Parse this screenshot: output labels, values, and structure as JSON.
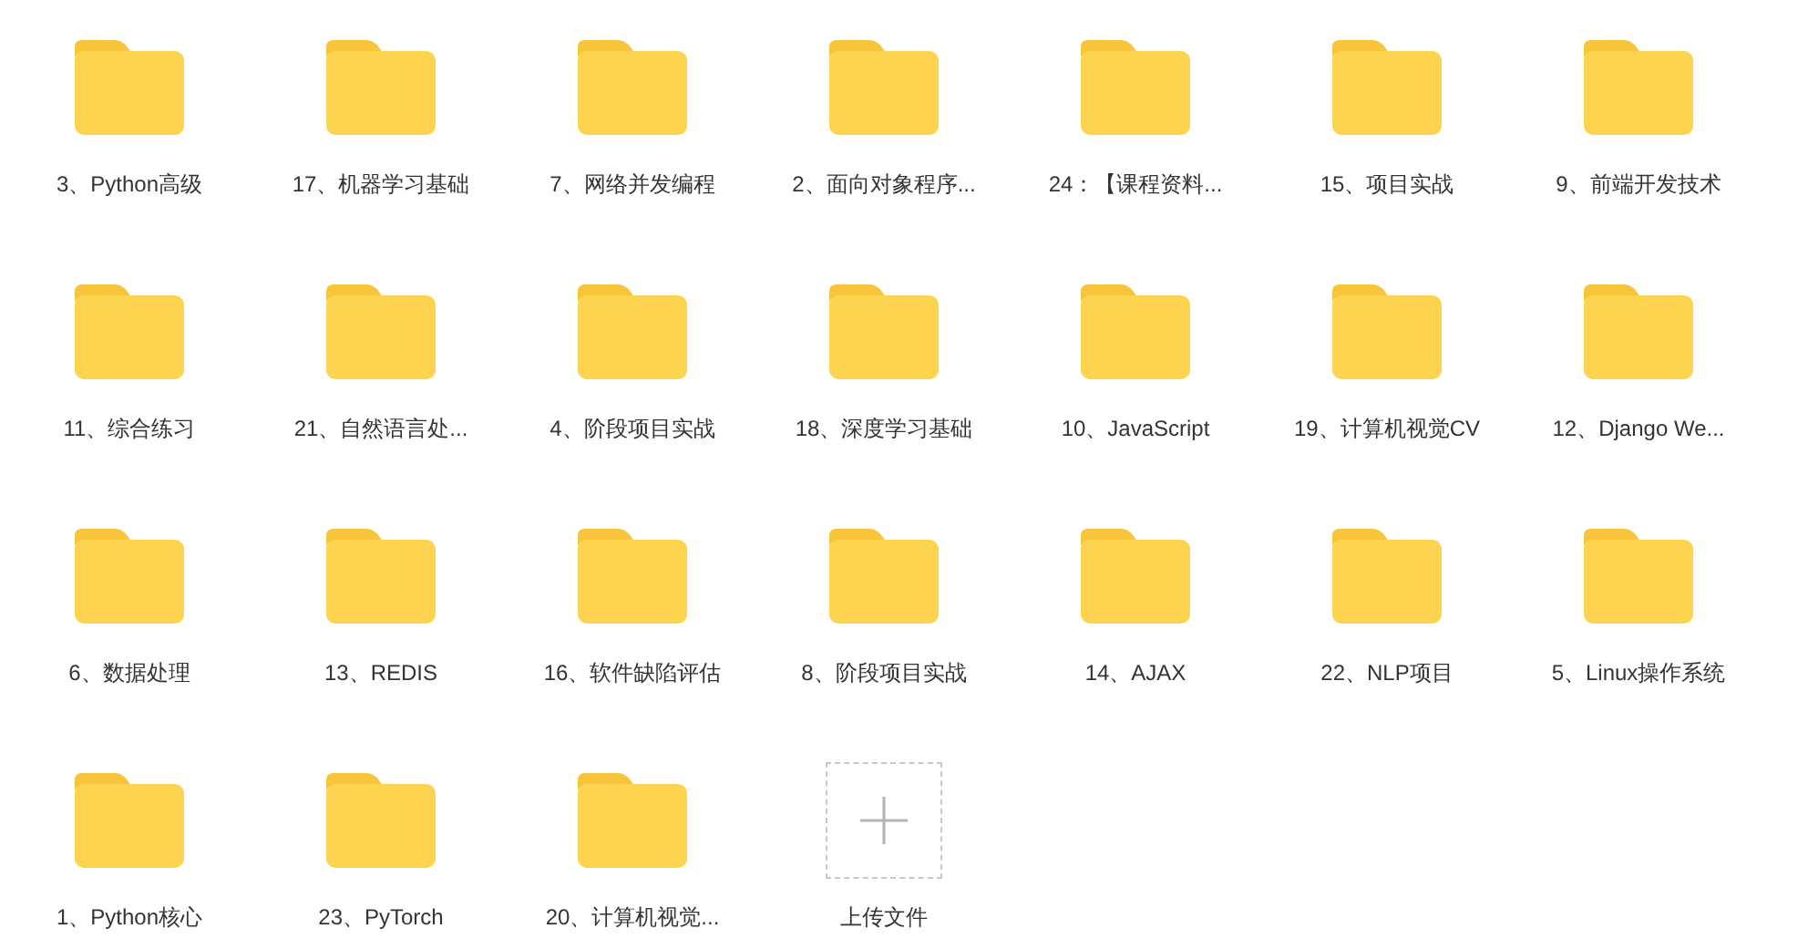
{
  "items": [
    {
      "kind": "folder",
      "label": "3、Python高级"
    },
    {
      "kind": "folder",
      "label": "17、机器学习基础"
    },
    {
      "kind": "folder",
      "label": "7、网络并发编程"
    },
    {
      "kind": "folder",
      "label": "2、面向对象程序..."
    },
    {
      "kind": "folder",
      "label": "24：【课程资料..."
    },
    {
      "kind": "folder",
      "label": "15、项目实战"
    },
    {
      "kind": "folder",
      "label": "9、前端开发技术"
    },
    {
      "kind": "folder",
      "label": "11、综合练习"
    },
    {
      "kind": "folder",
      "label": "21、自然语言处..."
    },
    {
      "kind": "folder",
      "label": "4、阶段项目实战"
    },
    {
      "kind": "folder",
      "label": "18、深度学习基础"
    },
    {
      "kind": "folder",
      "label": "10、JavaScript"
    },
    {
      "kind": "folder",
      "label": "19、计算机视觉CV"
    },
    {
      "kind": "folder",
      "label": "12、Django We..."
    },
    {
      "kind": "folder",
      "label": "6、数据处理"
    },
    {
      "kind": "folder",
      "label": "13、REDIS"
    },
    {
      "kind": "folder",
      "label": "16、软件缺陷评估"
    },
    {
      "kind": "folder",
      "label": "8、阶段项目实战"
    },
    {
      "kind": "folder",
      "label": "14、AJAX"
    },
    {
      "kind": "folder",
      "label": "22、NLP项目"
    },
    {
      "kind": "folder",
      "label": "5、Linux操作系统"
    },
    {
      "kind": "folder",
      "label": "1、Python核心"
    },
    {
      "kind": "folder",
      "label": "23、PyTorch"
    },
    {
      "kind": "folder",
      "label": "20、计算机视觉..."
    },
    {
      "kind": "upload",
      "label": "上传文件"
    }
  ]
}
